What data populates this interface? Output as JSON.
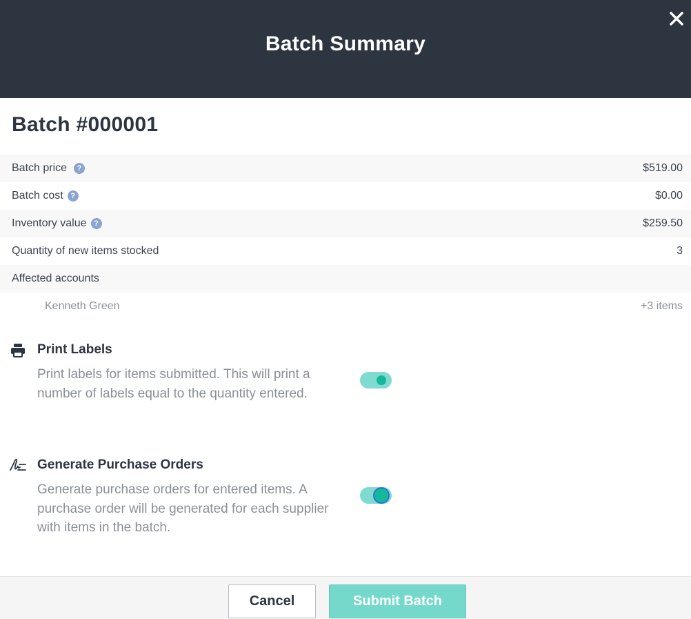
{
  "header": {
    "title": "Batch Summary"
  },
  "batch": {
    "title": "Batch #000001"
  },
  "summary": {
    "batch_price": {
      "label": "Batch price",
      "value": "$519.00"
    },
    "batch_cost": {
      "label": "Batch cost",
      "value": "$0.00"
    },
    "inventory_value": {
      "label": "Inventory value",
      "value": "$259.50"
    },
    "quantity": {
      "label": "Quantity of new items stocked",
      "value": "3"
    },
    "affected_accounts": {
      "label": "Affected accounts"
    },
    "accounts": [
      {
        "name": "Kenneth Green",
        "items": "+3 items"
      }
    ],
    "help_glyph": "?"
  },
  "print_labels": {
    "title": "Print Labels",
    "description": "Print labels for items submitted. This will print a number of labels equal to the quantity entered.",
    "enabled": true,
    "icon": "printer-icon"
  },
  "purchase_orders": {
    "title": "Generate Purchase Orders",
    "description": "Generate purchase orders for entered items. A purchase order will be generated for each supplier with items in the batch.",
    "enabled": true,
    "icon": "signature-icon"
  },
  "footer": {
    "cancel_label": "Cancel",
    "submit_label": "Submit Batch"
  },
  "colors": {
    "header_bg": "#2d3540",
    "accent": "#16b89c",
    "accent_light": "#74d9cb",
    "help_icon": "#8ba4cf"
  }
}
